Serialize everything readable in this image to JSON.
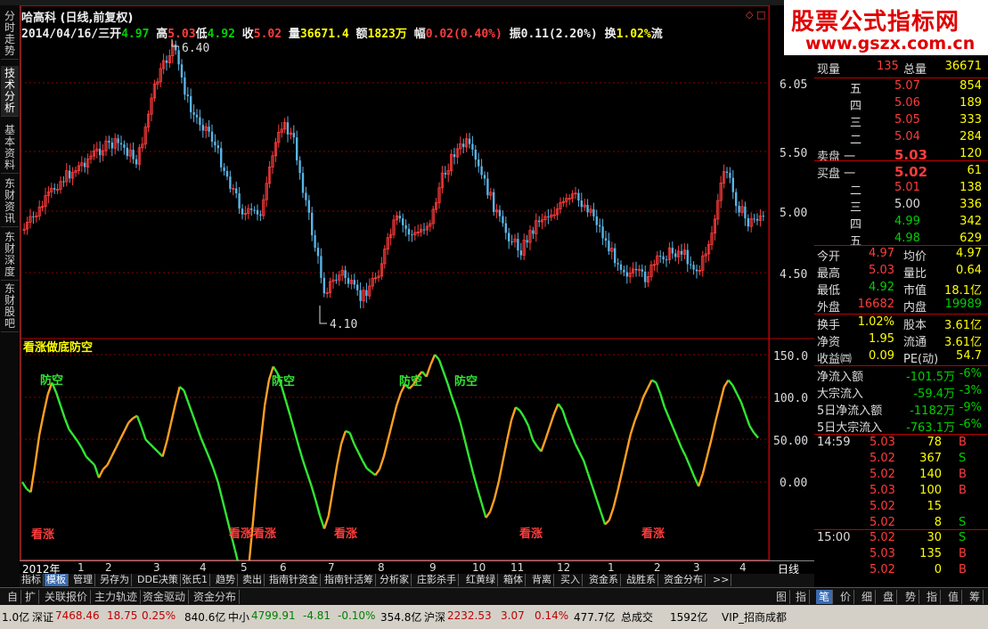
{
  "header": {
    "title": "哈高科 (日线,前复权)",
    "date": "2014/04/16/三",
    "open_label": "开",
    "open": "4.97",
    "high_label": "高",
    "high": "5.03",
    "low_label": "低",
    "low": "4.92",
    "close_label": "收",
    "close": "5.02",
    "vol_label": "量",
    "vol": "36671.4",
    "amt_label": "额",
    "amt": "1823万",
    "chg_label": "幅",
    "chg": "0.02(0.40%)",
    "amp_label": "振",
    "amp": "0.11(2.20%)",
    "turn_label": "换",
    "turn": "1.02%",
    "flow_label": "流"
  },
  "sidebar_tabs": [
    "分时走势",
    "技术分析",
    "基本资料",
    "东财资讯",
    "东财深度",
    "东财股吧"
  ],
  "logo": {
    "line1": "股票公式指标网",
    "line2": "www.gszx.com.cn"
  },
  "indicator_title": "看涨做底防空",
  "price_marks": {
    "high": "6.40",
    "low": "4.10"
  },
  "price_ticks": [
    "6.05",
    "5.50",
    "5.00",
    "4.50"
  ],
  "ind_ticks": [
    "150.0",
    "100.0",
    "50.00",
    "0.00"
  ],
  "signals": {
    "bear": "防空",
    "bull": "看涨"
  },
  "datebar": {
    "year": "2012年",
    "months": [
      "1",
      "2",
      "3",
      "4",
      "5",
      "6",
      "7",
      "8",
      "9",
      "10",
      "11",
      "12",
      "1",
      "2",
      "3",
      "4"
    ],
    "period": "日线"
  },
  "indicator_buttons": [
    "指标",
    "模板",
    "管理",
    "另存为",
    "DDE决策",
    "张氏1",
    "趋势",
    "卖出",
    "指南针资金",
    "指南针活筹",
    "分析家",
    "庄影杀手",
    "红黄绿",
    "箱体",
    "背离",
    "买入",
    "资金系",
    "战胜系",
    "资金分布",
    ">>"
  ],
  "bottom_tabs": [
    "自",
    "扩",
    "关联报价",
    "主力轨迹",
    "资金驱动",
    "资金分布"
  ],
  "right_tabs": [
    "图",
    "指",
    "笔",
    "价",
    "细",
    "盘",
    "势",
    "指",
    "值",
    "筹"
  ],
  "quote": {
    "xianliang_label": "现量",
    "xianliang": "135",
    "zongliang_label": "总量",
    "zongliang": "36671",
    "sell": [
      {
        "label": "五",
        "price": "5.07",
        "vol": "854"
      },
      {
        "label": "四",
        "price": "5.06",
        "vol": "189"
      },
      {
        "label": "三",
        "price": "5.05",
        "vol": "333"
      },
      {
        "label": "二",
        "price": "5.04",
        "vol": "284"
      },
      {
        "label": "卖盘 一",
        "price": "5.03",
        "vol": "120"
      }
    ],
    "buy": [
      {
        "label": "买盘 一",
        "price": "5.02",
        "vol": "61"
      },
      {
        "label": "二",
        "price": "5.01",
        "vol": "138"
      },
      {
        "label": "三",
        "price": "5.00",
        "vol": "336"
      },
      {
        "label": "四",
        "price": "4.99",
        "vol": "342"
      },
      {
        "label": "五",
        "price": "4.98",
        "vol": "629"
      }
    ],
    "stats": [
      {
        "l1": "今开",
        "v1": "4.97",
        "l2": "均价",
        "v2": "4.97"
      },
      {
        "l1": "最高",
        "v1": "5.03",
        "l2": "量比",
        "v2": "0.64"
      },
      {
        "l1": "最低",
        "v1": "4.92",
        "l2": "市值",
        "v2": "18.1亿"
      },
      {
        "l1": "外盘",
        "v1": "16682",
        "l2": "内盘",
        "v2": "19989"
      }
    ],
    "stats2": [
      {
        "l1": "换手",
        "v1": "1.02%",
        "l2": "股本",
        "v2": "3.61亿"
      },
      {
        "l1": "净资",
        "v1": "1.95",
        "l2": "流通",
        "v2": "3.61亿"
      },
      {
        "l1": "收益㈣",
        "v1": "0.09",
        "l2": "PE(动)",
        "v2": "54.7"
      }
    ],
    "flows": [
      {
        "label": "净流入额",
        "val": "-101.5万",
        "pct": "-6%"
      },
      {
        "label": "大宗流入",
        "val": "-59.4万",
        "pct": "-3%"
      },
      {
        "label": "5日净流入额",
        "val": "-1182万",
        "pct": "-9%"
      },
      {
        "label": "5日大宗流入",
        "val": "-763.1万",
        "pct": "-6%"
      }
    ],
    "trades1_time": "14:59",
    "trades1": [
      {
        "p": "5.03",
        "v": "78",
        "s": "B"
      },
      {
        "p": "5.02",
        "v": "367",
        "s": "S"
      },
      {
        "p": "5.02",
        "v": "140",
        "s": "B"
      },
      {
        "p": "5.03",
        "v": "100",
        "s": "B"
      },
      {
        "p": "5.02",
        "v": "15",
        "s": ""
      },
      {
        "p": "5.02",
        "v": "8",
        "s": "S"
      }
    ],
    "trades2_time": "15:00",
    "trades2": [
      {
        "p": "5.02",
        "v": "30",
        "s": "S"
      },
      {
        "p": "5.03",
        "v": "135",
        "s": "B"
      },
      {
        "p": "5.02",
        "v": "0",
        "s": "B"
      }
    ]
  },
  "statusbar": {
    "left": "1.0亿",
    "sz_label": "深证",
    "sz_val": "7468.46",
    "sz_chg": "18.75",
    "sz_pct": "0.25%",
    "sz_amt": "840.6亿",
    "zx_label": "中小",
    "zx_val": "4799.91",
    "zx_chg": "-4.81",
    "zx_pct": "-0.10%",
    "zx_amt": "354.8亿",
    "hs_label": "沪深",
    "hs_val": "2232.53",
    "hs_chg": "3.07",
    "hs_pct": "0.14%",
    "hs_amt": "477.7亿",
    "total_label": "总成交",
    "total": "1592亿",
    "vip": "VIP_招商成都"
  },
  "colors": {
    "up": "#ff3c3c",
    "down": "#00d000",
    "candle_down": "#5ab4e6",
    "ind_up": "#ffa020",
    "ind_down": "#32e632",
    "text_yellow": "#ffff00",
    "grid": "#8a0000"
  },
  "ind_series": [
    0,
    -8,
    -12,
    20,
    55,
    80,
    103,
    117,
    105,
    90,
    75,
    62,
    55,
    48,
    40,
    30,
    25,
    20,
    5,
    15,
    20,
    30,
    40,
    50,
    60,
    70,
    75,
    78,
    65,
    50,
    45,
    40,
    35,
    30,
    48,
    70,
    92,
    112,
    108,
    94,
    80,
    66,
    52,
    40,
    28,
    15,
    0,
    -20,
    -40,
    -60,
    -80,
    -100,
    -115,
    -112,
    -60,
    -5,
    45,
    90,
    120,
    136,
    128,
    112,
    95,
    78,
    60,
    42,
    25,
    10,
    -5,
    -22,
    -40,
    -55,
    -40,
    -10,
    20,
    45,
    60,
    58,
    45,
    35,
    25,
    16,
    12,
    8,
    15,
    30,
    50,
    70,
    90,
    105,
    115,
    110,
    115,
    124,
    130,
    124,
    138,
    150,
    144,
    130,
    116,
    100,
    86,
    70,
    50,
    30,
    10,
    -8,
    -25,
    -42,
    -35,
    -20,
    0,
    25,
    50,
    73,
    88,
    84,
    76,
    66,
    50,
    42,
    36,
    50,
    65,
    80,
    92,
    85,
    70,
    58,
    45,
    35,
    25,
    10,
    -5,
    -20,
    -35,
    -50,
    -45,
    -30,
    -10,
    12,
    34,
    56,
    72,
    85,
    100,
    110,
    120,
    117,
    104,
    88,
    76,
    64,
    52,
    40,
    30,
    18,
    6,
    -5,
    10,
    30,
    50,
    72,
    92,
    112,
    120,
    114,
    104,
    94,
    80,
    66,
    58,
    52
  ]
}
